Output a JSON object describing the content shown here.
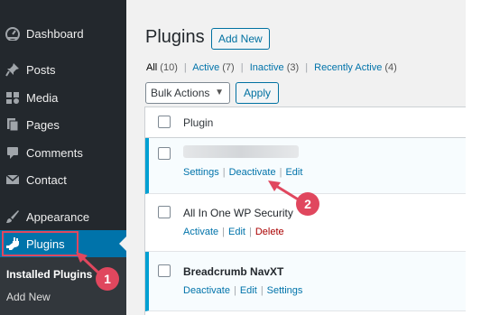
{
  "sidebar": {
    "items": [
      {
        "label": "Dashboard",
        "icon": "dashboard-icon"
      },
      {
        "label": "Posts",
        "icon": "pin-icon"
      },
      {
        "label": "Media",
        "icon": "media-icon"
      },
      {
        "label": "Pages",
        "icon": "pages-icon"
      },
      {
        "label": "Comments",
        "icon": "comment-icon"
      },
      {
        "label": "Contact",
        "icon": "mail-icon"
      },
      {
        "label": "Appearance",
        "icon": "brush-icon"
      },
      {
        "label": "Plugins",
        "icon": "plugin-icon",
        "active": true
      }
    ],
    "submenu": [
      {
        "label": "Installed Plugins",
        "current": true
      },
      {
        "label": "Add New"
      }
    ]
  },
  "header": {
    "title": "Plugins",
    "add_new": "Add New"
  },
  "filters": {
    "all": "All",
    "all_count": "(10)",
    "active": "Active",
    "active_count": "(7)",
    "inactive": "Inactive",
    "inactive_count": "(3)",
    "recently_active": "Recently Active",
    "recently_active_count": "(4)",
    "separator": "|"
  },
  "bulk": {
    "select_value": "Bulk Actions",
    "apply": "Apply"
  },
  "table": {
    "column_plugin": "Plugin",
    "rows": [
      {
        "name": "",
        "blurred": true,
        "actions": [
          "Settings",
          "Deactivate",
          "Edit"
        ]
      },
      {
        "name": "All In One WP Security",
        "actions": [
          "Activate",
          "Edit",
          "Delete"
        ]
      },
      {
        "name": "Breadcrumb NavXT",
        "actions": [
          "Deactivate",
          "Edit",
          "Settings"
        ]
      }
    ]
  },
  "callouts": {
    "one": "1",
    "two": "2",
    "color": "#e0475e"
  },
  "colors": {
    "sidebar_bg": "#23282d",
    "active_blue": "#0073aa",
    "link": "#0073aa",
    "active_row_border": "#00a0d2"
  }
}
